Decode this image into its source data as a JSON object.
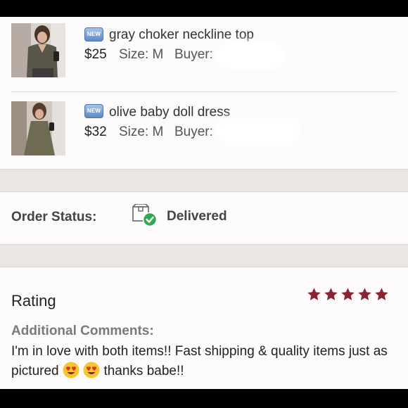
{
  "items": [
    {
      "badge": "NEW",
      "title": "gray choker neckline top",
      "price": "$25",
      "size": "Size: M",
      "buyer_label": "Buyer:"
    },
    {
      "badge": "NEW",
      "title": "olive baby doll dress",
      "price": "$32",
      "size": "Size: M",
      "buyer_label": "Buyer:"
    }
  ],
  "order_status": {
    "label": "Order Status:",
    "value": "Delivered",
    "icon": "package-delivered-icon"
  },
  "rating": {
    "label": "Rating",
    "stars": 5,
    "max_stars": 5,
    "star_color": "#8b2535"
  },
  "comments": {
    "label": "Additional Comments:",
    "text_before": "I'm in love with both items!! Fast shipping & quality items just as pictured",
    "text_after": "thanks babe!!"
  },
  "colors": {
    "accent_star": "#8b2535",
    "status_check": "#34a853",
    "new_badge": "#5f89c4"
  }
}
